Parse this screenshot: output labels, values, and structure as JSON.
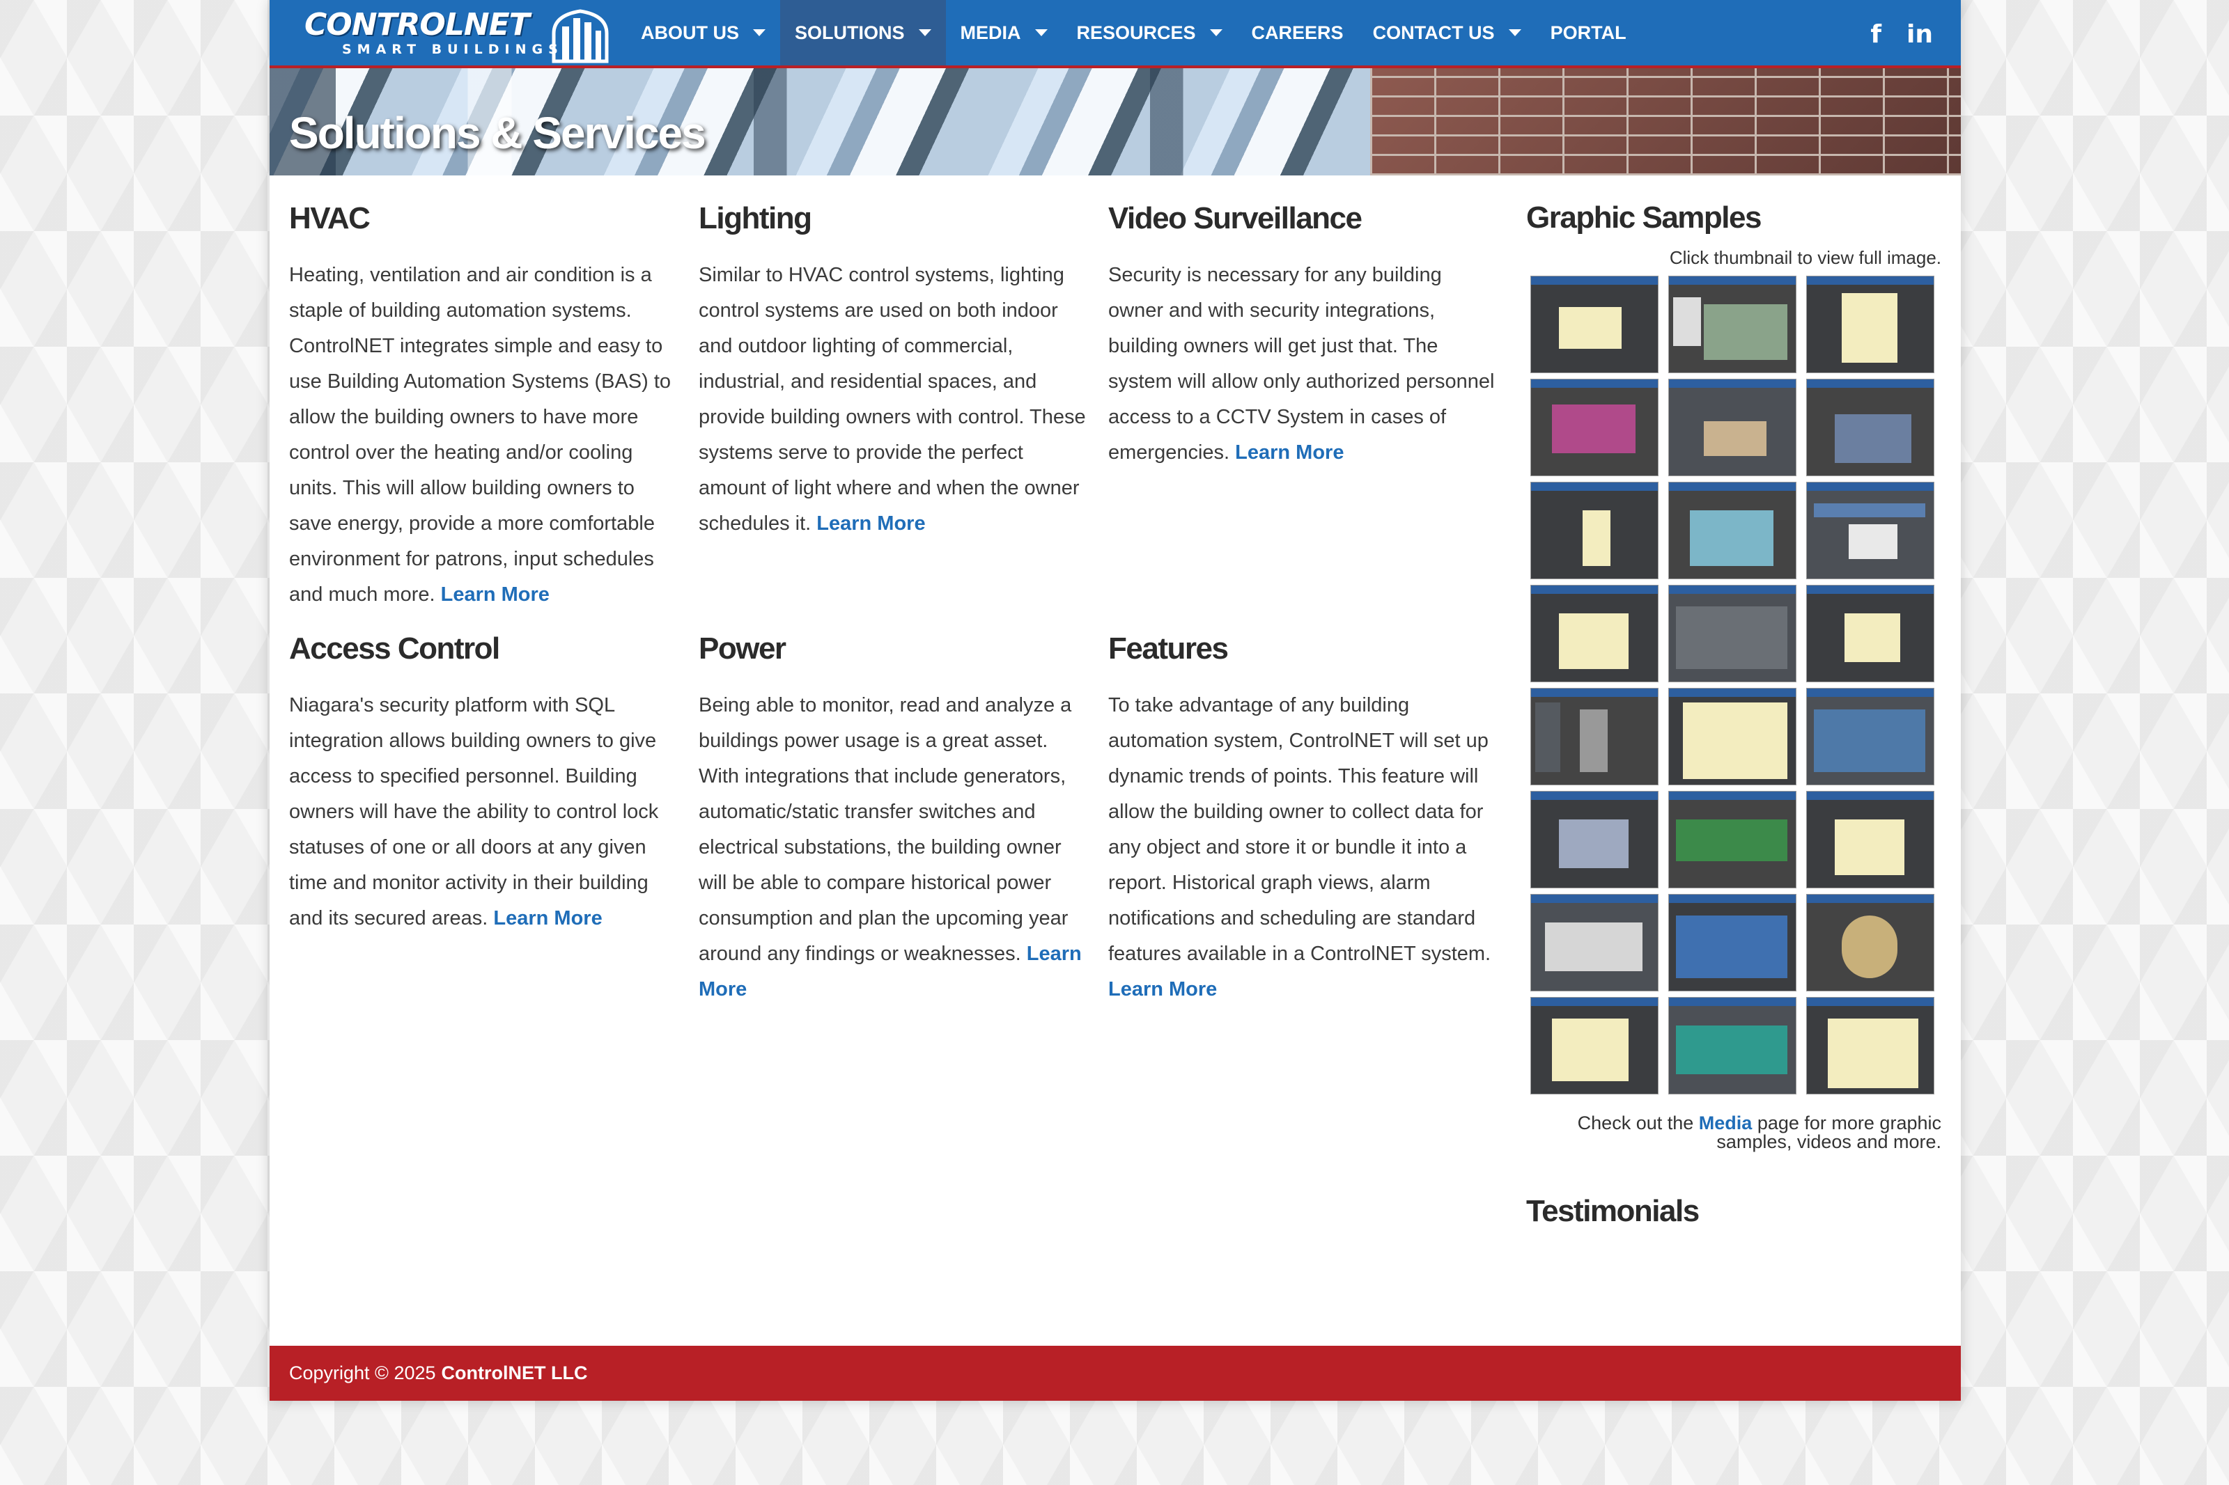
{
  "brand": {
    "logo_title": "CONTROLNET",
    "logo_subtitle": "SMART BUILDINGS"
  },
  "nav": {
    "items": [
      {
        "label": "ABOUT US",
        "has_dropdown": true
      },
      {
        "label": "SOLUTIONS",
        "has_dropdown": true,
        "active": true
      },
      {
        "label": "MEDIA",
        "has_dropdown": true
      },
      {
        "label": "RESOURCES",
        "has_dropdown": true
      },
      {
        "label": "CAREERS",
        "has_dropdown": false
      },
      {
        "label": "CONTACT US",
        "has_dropdown": true
      },
      {
        "label": "PORTAL",
        "has_dropdown": false
      }
    ],
    "social": [
      {
        "icon": "facebook-icon",
        "glyph": "f"
      },
      {
        "icon": "linkedin-icon",
        "glyph": "in"
      }
    ]
  },
  "banner": {
    "title": "Solutions & Services"
  },
  "sections": {
    "hvac": {
      "title": "HVAC",
      "body": "Heating, ventilation and air condition is a staple of building automation systems. ControlNET integrates simple and easy to use Building Automation Systems (BAS) to allow the building owners to have more control over the heating and/or cooling units. This will allow building owners to save energy, provide a more comfortable environment for patrons, input schedules and much more.",
      "link": "Learn More"
    },
    "lighting": {
      "title": "Lighting",
      "body": "Similar to HVAC control systems, lighting control systems are used on both indoor and outdoor lighting of commercial, industrial, and residential spaces, and provide building owners with control. These systems serve to provide the perfect amount of light where and when the owner schedules it.",
      "link": "Learn More"
    },
    "video": {
      "title": "Video Surveillance",
      "body": "Security is necessary for any building owner and with security integrations, building owners will get just that. The system will allow only authorized personnel access to a CCTV System in cases of emergencies.",
      "link": "Learn More"
    },
    "access": {
      "title": "Access Control",
      "body": "Niagara's security platform with SQL integration allows building owners to give access to specified personnel. Building owners will have the ability to control lock statuses of one or all doors at any given time and monitor activity in their building and its secured areas.",
      "link": "Learn More"
    },
    "power": {
      "title": "Power",
      "body": "Being able to monitor, read and analyze a buildings power usage is a great asset. With integrations that include generators, automatic/static transfer switches and electrical substations, the building owner will be able to compare historical power consumption and plan the upcoming year around any findings or weaknesses.",
      "link": "Learn More"
    },
    "features": {
      "title": "Features",
      "body": "To take advantage of any building automation system, ControlNET will set up dynamic trends of points. This feature will allow the building owner to collect data for any object and store it or bundle it into a report. Historical graph views, alarm notifications and scheduling are standard features available in a ControlNET system.",
      "link": "Learn More"
    }
  },
  "sidebar": {
    "title": "Graphic Samples",
    "hint": "Click thumbnail to view full image.",
    "more_prefix": "Check out the",
    "more_link": "Media",
    "more_suffix": "page for more graphic samples, videos and more.",
    "testimonials_title": "Testimonials"
  },
  "footer": {
    "copyright": "Copyright © 2025",
    "company": "ControlNET LLC"
  },
  "colors": {
    "header_blue": "#1f6db8",
    "accent_red": "#b82026",
    "link_blue": "#1f6db8"
  }
}
